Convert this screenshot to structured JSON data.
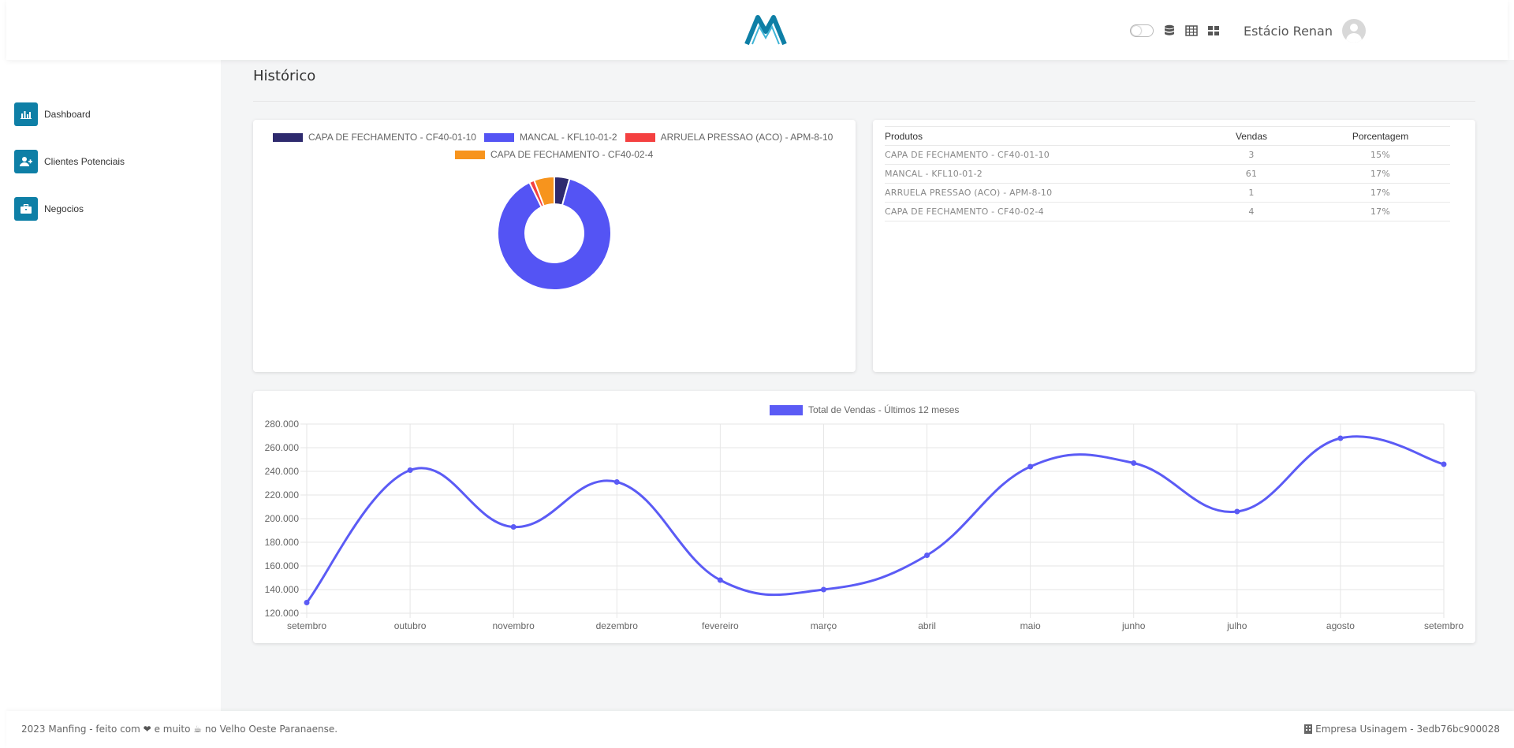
{
  "header": {
    "user_name": "Estácio Renan",
    "icons": [
      "theme-toggle",
      "database-icon",
      "table-icon",
      "grid-icon",
      "avatar"
    ]
  },
  "sidebar": {
    "items": [
      {
        "label": "Dashboard",
        "icon": "bar-chart-icon"
      },
      {
        "label": "Clientes Potenciais",
        "icon": "user-plus-icon"
      },
      {
        "label": "Negocios",
        "icon": "briefcase-icon"
      }
    ]
  },
  "main": {
    "title": "Histórico"
  },
  "table": {
    "headers": [
      "Produtos",
      "Vendas",
      "Porcentagem"
    ],
    "rows": [
      [
        "CAPA DE FECHAMENTO - CF40-01-10",
        "3",
        "15%"
      ],
      [
        "MANCAL - KFL10-01-2",
        "61",
        "17%"
      ],
      [
        "ARRUELA PRESSAO (ACO) - APM-8-10",
        "1",
        "17%"
      ],
      [
        "CAPA DE FECHAMENTO - CF40-02-4",
        "4",
        "17%"
      ]
    ]
  },
  "footer": {
    "left_prefix": "2023 Manfing - feito com",
    "left_mid": "e muito",
    "left_suffix": "no Velho Oeste Paranaense.",
    "right": "Empresa Usinagem - 3edb76bc900028"
  },
  "colors": {
    "accent": "#0e7fa6",
    "series": "#5b5bf5",
    "slice_1": "#2e2a6e",
    "slice_2": "#5454f4",
    "slice_3": "#f44040",
    "slice_4": "#f7941d"
  },
  "chart_data": [
    {
      "type": "pie",
      "variant": "doughnut",
      "categories": [
        "CAPA DE FECHAMENTO - CF40-01-10",
        "MANCAL - KFL10-01-2",
        "ARRUELA PRESSAO (ACO) - APM-8-10",
        "CAPA DE FECHAMENTO - CF40-02-4"
      ],
      "values": [
        3,
        61,
        1,
        4
      ],
      "colors": [
        "#2e2a6e",
        "#5454f4",
        "#f44040",
        "#f7941d"
      ],
      "legend": "top"
    },
    {
      "type": "line",
      "series": [
        {
          "name": "Total de Vendas - Últimos 12 meses",
          "values": [
            129000,
            241000,
            193000,
            231000,
            148000,
            140000,
            169000,
            244000,
            247000,
            206000,
            268000,
            246000
          ]
        }
      ],
      "categories": [
        "setembro",
        "outubro",
        "novembro",
        "dezembro",
        "fevereiro",
        "março",
        "abril",
        "maio",
        "junho",
        "julho",
        "agosto",
        "setembro"
      ],
      "ylim": [
        120000,
        280000
      ],
      "yticks": [
        "120.000",
        "140.000",
        "160.000",
        "180.000",
        "200.000",
        "220.000",
        "240.000",
        "260.000",
        "280.000"
      ],
      "grid": true,
      "legend": "top",
      "smooth": true
    }
  ]
}
